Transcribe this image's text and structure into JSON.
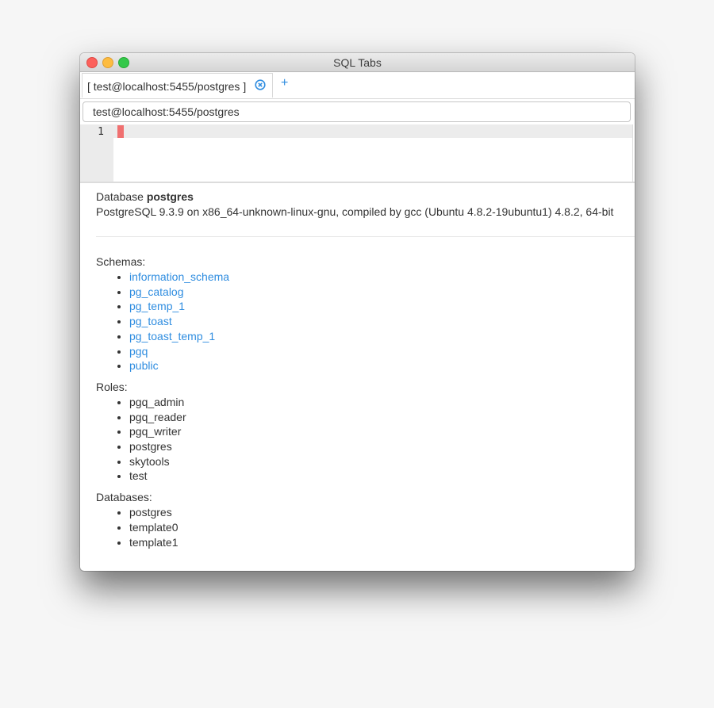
{
  "window": {
    "title": "SQL Tabs"
  },
  "tabs": [
    {
      "label": "[ test@localhost:5455/postgres ]"
    }
  ],
  "tab_add_label": "+",
  "connection": {
    "value": "test@localhost:5455/postgres"
  },
  "editor": {
    "line_number": "1"
  },
  "results": {
    "db_prefix": "Database ",
    "db_name": "postgres",
    "version": "PostgreSQL 9.3.9 on x86_64-unknown-linux-gnu, compiled by gcc (Ubuntu 4.8.2-19ubuntu1) 4.8.2, 64-bit",
    "schemas_label": "Schemas:",
    "schemas": [
      "information_schema",
      "pg_catalog",
      "pg_temp_1",
      "pg_toast",
      "pg_toast_temp_1",
      "pgq",
      "public"
    ],
    "roles_label": "Roles:",
    "roles": [
      "pgq_admin",
      "pgq_reader",
      "pgq_writer",
      "postgres",
      "skytools",
      "test"
    ],
    "databases_label": "Databases:",
    "databases": [
      "postgres",
      "template0",
      "template1"
    ]
  },
  "colors": {
    "link": "#2f8de0",
    "cursor": "#f07070",
    "close_button": "#fc605b",
    "minimize_button": "#fdbc40",
    "maximize_button": "#34c84a"
  },
  "icons": {
    "tab_close": "circle-x-icon",
    "tab_add": "plus-icon"
  }
}
